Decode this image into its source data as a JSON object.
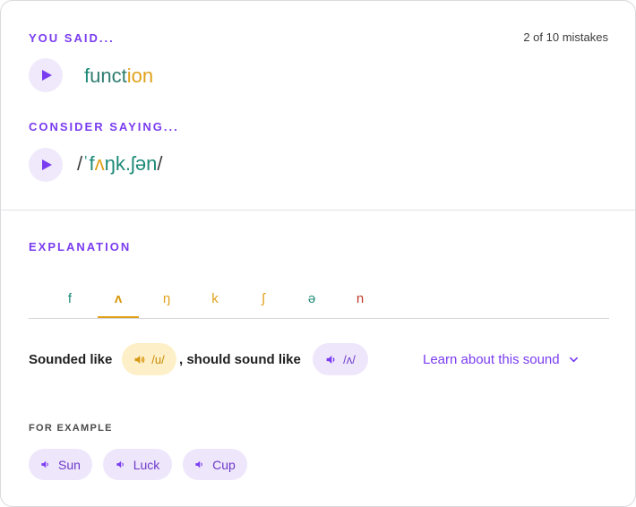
{
  "you_said": {
    "heading": "YOU SAID...",
    "mistakes": "2 of 10 mistakes",
    "word_parts": [
      {
        "text": "f",
        "color": "#1d8a78"
      },
      {
        "text": "unct",
        "color": "#2f7d6f"
      },
      {
        "text": "io",
        "color": "#e0a11b"
      },
      {
        "text": "n",
        "color": "#e0a11b"
      }
    ]
  },
  "consider_saying": {
    "heading": "CONSIDER SAYING...",
    "ipa_parts": [
      {
        "text": "/",
        "color": "#3d3d3d"
      },
      {
        "text": "ˈf",
        "color": "#1d8a78"
      },
      {
        "text": "ʌ",
        "color": "#e0a11b"
      },
      {
        "text": "ŋk.ʃ",
        "color": "#1d8a78"
      },
      {
        "text": "ə",
        "color": "#1d8a78"
      },
      {
        "text": "n",
        "color": "#1d8a78"
      },
      {
        "text": "/",
        "color": "#3d3d3d"
      }
    ]
  },
  "explanation": {
    "heading": "EXPLANATION",
    "phonemes": [
      {
        "symbol": "f",
        "color": "#1d8a78",
        "active": false
      },
      {
        "symbol": "ʌ",
        "color": "#d8970f",
        "active": true
      },
      {
        "symbol": "ŋ",
        "color": "#e0a11b",
        "active": false
      },
      {
        "symbol": "k",
        "color": "#e0a11b",
        "active": false
      },
      {
        "symbol": "ʃ",
        "color": "#e0a11b",
        "active": false
      },
      {
        "symbol": "ə",
        "color": "#1d8a78",
        "active": false
      },
      {
        "symbol": "n",
        "color": "#c0392b",
        "active": false
      }
    ],
    "sounded_like_label": "Sounded like",
    "sounded_like_value": "/u/",
    "should_sound_label": ", should sound like",
    "should_sound_value": "/ʌ/",
    "learn_link": "Learn about this sound"
  },
  "examples": {
    "heading": "FOR EXAMPLE",
    "words": [
      "Sun",
      "Luck",
      "Cup"
    ]
  },
  "colors": {
    "accent": "#7a3cf0",
    "wrong_sound_bg": "#fdf0c8",
    "wrong_sound_fg": "#c98a05",
    "right_sound_bg": "#eee6fb",
    "right_sound_fg": "#6e3ac9"
  },
  "icons": [
    "play-icon",
    "speaker-icon",
    "chevron-down-icon"
  ]
}
